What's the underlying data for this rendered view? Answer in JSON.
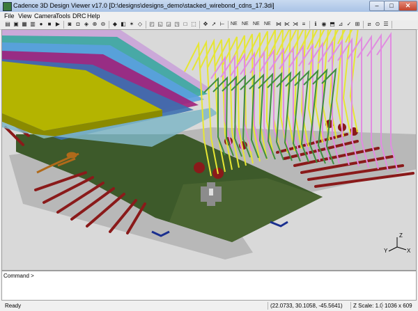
{
  "window": {
    "title": "Cadence 3D Design Viewer v17.0 [D:\\designs\\designs_demo\\stacked_wirebond_cdns_17.3di]",
    "controls": {
      "minimize": "–",
      "maximize": "□",
      "close": "✕"
    }
  },
  "menu": [
    "File",
    "View",
    "Camera",
    "Tools",
    "DRC",
    "Help"
  ],
  "toolbar": {
    "groups": [
      [
        "folder-open-icon",
        "save-icon",
        "save-as-icon",
        "print-icon",
        "record-icon",
        "stop-icon",
        "play-icon"
      ],
      [
        "camera-icon",
        "snapshot-icon",
        "render-icon",
        "zoom-in-icon",
        "zoom-out-icon"
      ],
      [
        "color-icon",
        "layer-icon",
        "light-icon",
        "wireframe-icon"
      ],
      [
        "view-iso-icon",
        "view-top-icon",
        "view-left-icon",
        "view-front-icon",
        "view-box-icon",
        "view-fit-icon"
      ],
      [
        "pan-icon",
        "select-icon",
        "measure-icon"
      ],
      [
        "net-icon",
        "net-highlight-icon",
        "net-clear-icon",
        "net-list-icon"
      ],
      [
        "info-icon",
        "eye-icon",
        "shape-icon",
        "ruler-icon",
        "check-icon",
        "tree-icon"
      ],
      [
        "cross-section-icon",
        "pin-icon",
        "layers-panel-icon"
      ]
    ],
    "text_buttons": [
      "NE",
      "NE",
      "NE",
      "NE"
    ]
  },
  "command": {
    "prompt": "Command >"
  },
  "status": {
    "ready": "Ready",
    "coordinates": "(22.0733, 30.1058, -45.5641)",
    "zscale": "Z Scale: 1.0",
    "dimensions": "1036 x 609"
  },
  "scene": {
    "axis_labels": {
      "x": "X",
      "y": "Y",
      "z": "Z"
    },
    "colors": {
      "background": "#d9d9d9",
      "board": "#3d5a2a",
      "copper": "#8a1a1a",
      "wire_yellow": "#e6e633",
      "wire_pink": "#e18ce1",
      "wire_green": "#3f8f3f",
      "die_yellow": "#b4b400",
      "die_cyan": "#7fb6c5",
      "pad_blue": "#1a2f8f"
    }
  }
}
